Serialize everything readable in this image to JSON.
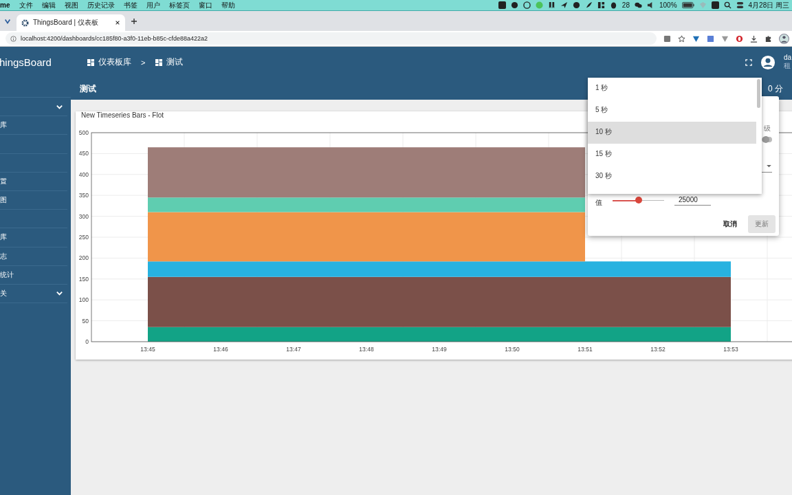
{
  "menu_bar": {
    "app": "me",
    "menus": [
      "文件",
      "编辑",
      "视图",
      "历史记录",
      "书签",
      "用户",
      "标签页",
      "窗口",
      "帮助"
    ],
    "badge_count": "28",
    "battery": "100%",
    "clock": "4月28日 周三"
  },
  "browser": {
    "tab_title": "ThingsBoard | 仪表板",
    "address": "localhost:4200/dashboards/cc185f80-a3f0-11eb-b85c-cfde88a422a2"
  },
  "header": {
    "logo": "hingsBoard",
    "breadcrumbs": [
      {
        "label": "仪表板库"
      },
      {
        "label": "测试"
      }
    ],
    "separator": ">",
    "user_name": "da",
    "user_role": "租"
  },
  "sidebar": {
    "items": [
      {
        "expandable": true
      },
      {
        "label": "库",
        "expandable": false
      },
      {
        "expandable": false
      },
      {
        "expandable": false
      },
      {
        "label": "置",
        "expandable": false
      },
      {
        "label": "图",
        "expandable": false
      },
      {
        "expandable": false
      },
      {
        "label": "库",
        "expandable": false
      },
      {
        "label": "志",
        "expandable": false
      },
      {
        "label": "统计",
        "expandable": false
      },
      {
        "label": "关",
        "expandable": true
      }
    ]
  },
  "toolbar": {
    "title": "测试",
    "timewindow": "0 分"
  },
  "widget": {
    "title": "New Timeseries Bars - Flot",
    "chart_data": {
      "type": "area",
      "stacked": true,
      "grid": true,
      "x": [
        "13:45",
        "13:46",
        "13:47",
        "13:48",
        "13:49",
        "13:50",
        "13:51",
        "13:52",
        "13:53"
      ],
      "ylim": [
        0,
        500
      ],
      "yticks": [
        0,
        50,
        100,
        150,
        200,
        250,
        300,
        350,
        400,
        450,
        500
      ],
      "series": [
        {
          "color": "#12a386",
          "values": [
            35,
            35,
            35,
            35,
            35,
            35,
            35,
            35,
            35
          ]
        },
        {
          "color": "#7b5049",
          "values": [
            120,
            120,
            120,
            120,
            120,
            120,
            120,
            120,
            120
          ]
        },
        {
          "color": "#27b2e0",
          "values": [
            37,
            37,
            37,
            37,
            37,
            37,
            37,
            37,
            37
          ]
        },
        {
          "color": "#f0954a",
          "values": [
            118,
            118,
            118,
            118,
            118,
            118,
            118,
            null,
            null
          ]
        },
        {
          "color": "#5fcdb0",
          "values": [
            35,
            35,
            35,
            35,
            35,
            35,
            35,
            null,
            null
          ]
        },
        {
          "color": "#9e7d78",
          "values": [
            120,
            120,
            120,
            120,
            120,
            120,
            120,
            null,
            null
          ]
        }
      ]
    }
  },
  "settings_dialog": {
    "label_fragment": "级",
    "toggle": {
      "on": false
    },
    "max_label": "值",
    "slider": {
      "level": 0.5
    },
    "max_value": "25000",
    "buttons": [
      {
        "label": "取消",
        "disabled": false
      },
      {
        "label": "更新",
        "disabled": true
      }
    ]
  },
  "interval_dropdown": {
    "options": [
      {
        "label": "1 秒",
        "selected": false
      },
      {
        "label": "5 秒",
        "selected": false
      },
      {
        "label": "10 秒",
        "selected": true
      },
      {
        "label": "15 秒",
        "selected": false
      },
      {
        "label": "30 秒",
        "selected": false
      }
    ]
  }
}
